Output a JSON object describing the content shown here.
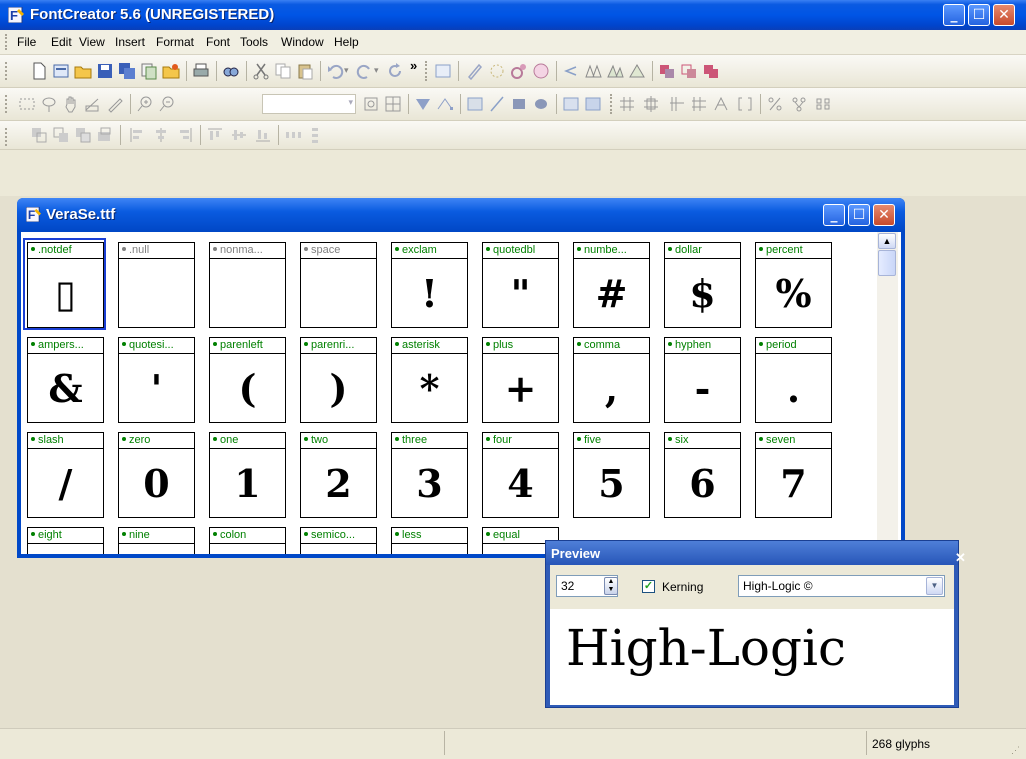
{
  "window": {
    "title": "FontCreator 5.6 (UNREGISTERED)"
  },
  "menu": [
    "File",
    "Edit",
    "View",
    "Insert",
    "Format",
    "Font",
    "Tools",
    "Window",
    "Help"
  ],
  "child_window": {
    "title": "VeraSe.ttf"
  },
  "glyphs": [
    {
      "name": ".notdef",
      "char": "▯"
    },
    {
      "name": ".null",
      "char": ""
    },
    {
      "name": "nonma...",
      "char": ""
    },
    {
      "name": "space",
      "char": ""
    },
    {
      "name": "exclam",
      "char": "!"
    },
    {
      "name": "quotedbl",
      "char": "\""
    },
    {
      "name": "numbe...",
      "char": "#"
    },
    {
      "name": "dollar",
      "char": "$"
    },
    {
      "name": "percent",
      "char": "%"
    },
    {
      "name": "ampers...",
      "char": "&"
    },
    {
      "name": "quotesi...",
      "char": "'"
    },
    {
      "name": "parenleft",
      "char": "("
    },
    {
      "name": "parenri...",
      "char": ")"
    },
    {
      "name": "asterisk",
      "char": "*"
    },
    {
      "name": "plus",
      "char": "+"
    },
    {
      "name": "comma",
      "char": ","
    },
    {
      "name": "hyphen",
      "char": "-"
    },
    {
      "name": "period",
      "char": "."
    },
    {
      "name": "slash",
      "char": "/"
    },
    {
      "name": "zero",
      "char": "0"
    },
    {
      "name": "one",
      "char": "1"
    },
    {
      "name": "two",
      "char": "2"
    },
    {
      "name": "three",
      "char": "3"
    },
    {
      "name": "four",
      "char": "4"
    },
    {
      "name": "five",
      "char": "5"
    },
    {
      "name": "six",
      "char": "6"
    },
    {
      "name": "seven",
      "char": "7"
    },
    {
      "name": "eight",
      "char": ""
    },
    {
      "name": "nine",
      "char": ""
    },
    {
      "name": "colon",
      "char": ""
    },
    {
      "name": "semico...",
      "char": ""
    },
    {
      "name": "less",
      "char": ""
    },
    {
      "name": "equal",
      "char": ""
    }
  ],
  "preview": {
    "title": "Preview",
    "size": "32",
    "kerning_label": "Kerning",
    "kerning_checked": true,
    "font": "High-Logic ©",
    "sample_text": "High-Logic"
  },
  "status": {
    "glyph_count": "268 glyphs"
  }
}
